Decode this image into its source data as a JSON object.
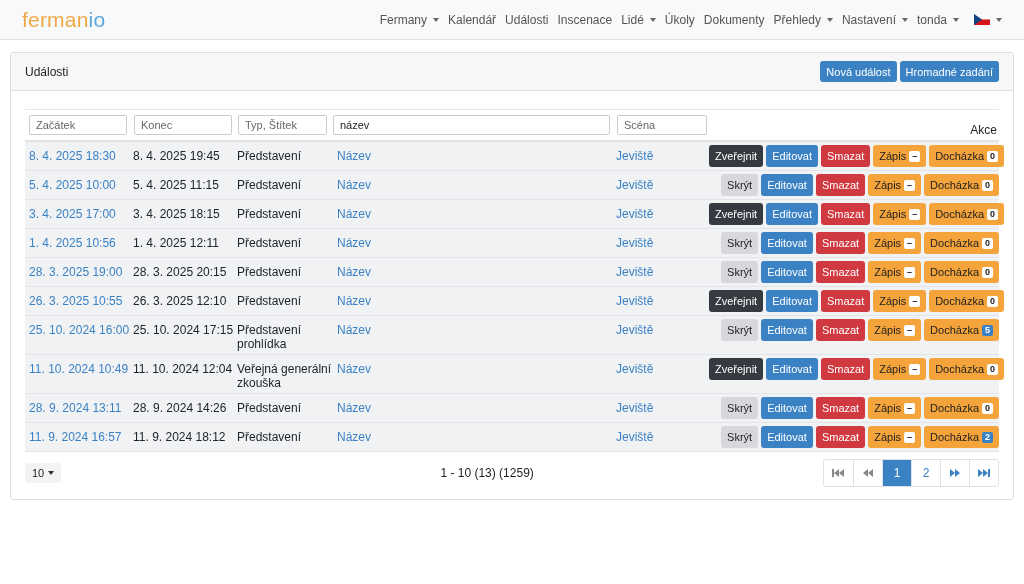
{
  "navbar": {
    "brand": {
      "main": "ferman",
      "accent": "io"
    },
    "items": [
      {
        "label": "Fermany",
        "dropdown": true
      },
      {
        "label": "Kalendář",
        "dropdown": false
      },
      {
        "label": "Události",
        "dropdown": false
      },
      {
        "label": "Inscenace",
        "dropdown": false
      },
      {
        "label": "Lidé",
        "dropdown": true
      },
      {
        "label": "Úkoly",
        "dropdown": false
      },
      {
        "label": "Dokumenty",
        "dropdown": false
      },
      {
        "label": "Přehledy",
        "dropdown": true
      },
      {
        "label": "Nastavení",
        "dropdown": true
      },
      {
        "label": "tonda",
        "dropdown": true
      }
    ],
    "language": {
      "dropdown": true
    }
  },
  "card": {
    "title": "Události",
    "buttons": [
      "Nová událost",
      "Hromadné zadání"
    ]
  },
  "filters": [
    {
      "placeholder": "Začátek"
    },
    {
      "placeholder": "Konec"
    },
    {
      "placeholder": "Typ, Štítek"
    },
    {
      "value": "název"
    },
    {
      "placeholder": "Scéna"
    }
  ],
  "actions_header": "Akce",
  "rows": [
    {
      "start": "8. 4. 2025 18:30",
      "end": "8. 4. 2025 19:45",
      "type": "Představení",
      "name": "Název",
      "scene": "Jeviště",
      "visibility": {
        "kind": "publish",
        "label": "Zveřejnit"
      },
      "edit": "Editovat",
      "delete": "Smazat",
      "signup": {
        "label": "Zápis",
        "badge": "–"
      },
      "attendance": {
        "label": "Docházka",
        "badge": "0",
        "color": "#ffffff"
      }
    },
    {
      "start": "5. 4. 2025 10:00",
      "end": "5. 4. 2025 11:15",
      "type": "Představení",
      "name": "Název",
      "scene": "Jeviště",
      "visibility": {
        "kind": "hide",
        "label": "Skrýt"
      },
      "edit": "Editovat",
      "delete": "Smazat",
      "signup": {
        "label": "Zápis",
        "badge": "–"
      },
      "attendance": {
        "label": "Docházka",
        "badge": "0",
        "color": "#ffffff"
      }
    },
    {
      "start": "3. 4. 2025 17:00",
      "end": "3. 4. 2025 18:15",
      "type": "Představení",
      "name": "Název",
      "scene": "Jeviště",
      "visibility": {
        "kind": "publish",
        "label": "Zveřejnit"
      },
      "edit": "Editovat",
      "delete": "Smazat",
      "signup": {
        "label": "Zápis",
        "badge": "–"
      },
      "attendance": {
        "label": "Docházka",
        "badge": "0",
        "color": "#ffffff"
      }
    },
    {
      "start": "1. 4. 2025 10:56",
      "end": "1. 4. 2025 12:11",
      "type": "Představení",
      "name": "Název",
      "scene": "Jeviště",
      "visibility": {
        "kind": "hide",
        "label": "Skrýt"
      },
      "edit": "Editovat",
      "delete": "Smazat",
      "signup": {
        "label": "Zápis",
        "badge": "–"
      },
      "attendance": {
        "label": "Docházka",
        "badge": "0",
        "color": "#ffffff"
      }
    },
    {
      "start": "28. 3. 2025 19:00",
      "end": "28. 3. 2025 20:15",
      "type": "Představení",
      "name": "Název",
      "scene": "Jeviště",
      "visibility": {
        "kind": "hide",
        "label": "Skrýt"
      },
      "edit": "Editovat",
      "delete": "Smazat",
      "signup": {
        "label": "Zápis",
        "badge": "–"
      },
      "attendance": {
        "label": "Docházka",
        "badge": "0",
        "color": "#ffffff"
      }
    },
    {
      "start": "26. 3. 2025 10:55",
      "end": "26. 3. 2025 12:10",
      "type": "Představení",
      "name": "Název",
      "scene": "Jeviště",
      "visibility": {
        "kind": "publish",
        "label": "Zveřejnit"
      },
      "edit": "Editovat",
      "delete": "Smazat",
      "signup": {
        "label": "Zápis",
        "badge": "–"
      },
      "attendance": {
        "label": "Docházka",
        "badge": "0",
        "color": "#ffffff"
      }
    },
    {
      "start": "25. 10. 2024 16:00",
      "end": "25. 10. 2024 17:15",
      "type": "Představení prohlídka",
      "name": "Název",
      "scene": "Jeviště",
      "visibility": {
        "kind": "hide",
        "label": "Skrýt"
      },
      "edit": "Editovat",
      "delete": "Smazat",
      "signup": {
        "label": "Zápis",
        "badge": "–"
      },
      "attendance": {
        "label": "Docházka",
        "badge": "5",
        "color": "#3b82c4"
      }
    },
    {
      "start": "11. 10. 2024 10:49",
      "end": "11. 10. 2024 12:04",
      "type": "Veřejná generální zkouška",
      "name": "Název",
      "scene": "Jeviště",
      "visibility": {
        "kind": "publish",
        "label": "Zveřejnit"
      },
      "edit": "Editovat",
      "delete": "Smazat",
      "signup": {
        "label": "Zápis",
        "badge": "–"
      },
      "attendance": {
        "label": "Docházka",
        "badge": "0",
        "color": "#ffffff"
      }
    },
    {
      "start": "28. 9. 2024 13:11",
      "end": "28. 9. 2024 14:26",
      "type": "Představení",
      "name": "Název",
      "scene": "Jeviště",
      "visibility": {
        "kind": "hide",
        "label": "Skrýt"
      },
      "edit": "Editovat",
      "delete": "Smazat",
      "signup": {
        "label": "Zápis",
        "badge": "–"
      },
      "attendance": {
        "label": "Docházka",
        "badge": "0",
        "color": "#ffffff"
      }
    },
    {
      "start": "11. 9. 2024 16:57",
      "end": "11. 9. 2024 18:12",
      "type": "Představení",
      "name": "Název",
      "scene": "Jeviště",
      "visibility": {
        "kind": "hide",
        "label": "Skrýt"
      },
      "edit": "Editovat",
      "delete": "Smazat",
      "signup": {
        "label": "Zápis",
        "badge": "–"
      },
      "attendance": {
        "label": "Docházka",
        "badge": "2",
        "color": "#3b82c4"
      }
    }
  ],
  "footer": {
    "page_size": "10",
    "summary": "1 - 10 (13) (1259)",
    "pagination": [
      {
        "kind": "first",
        "selected": false
      },
      {
        "kind": "prev",
        "selected": false
      },
      {
        "kind": "page",
        "label": "1",
        "selected": true
      },
      {
        "kind": "page",
        "label": "2",
        "selected": false
      },
      {
        "kind": "next",
        "selected": false
      },
      {
        "kind": "last",
        "selected": false
      }
    ]
  }
}
